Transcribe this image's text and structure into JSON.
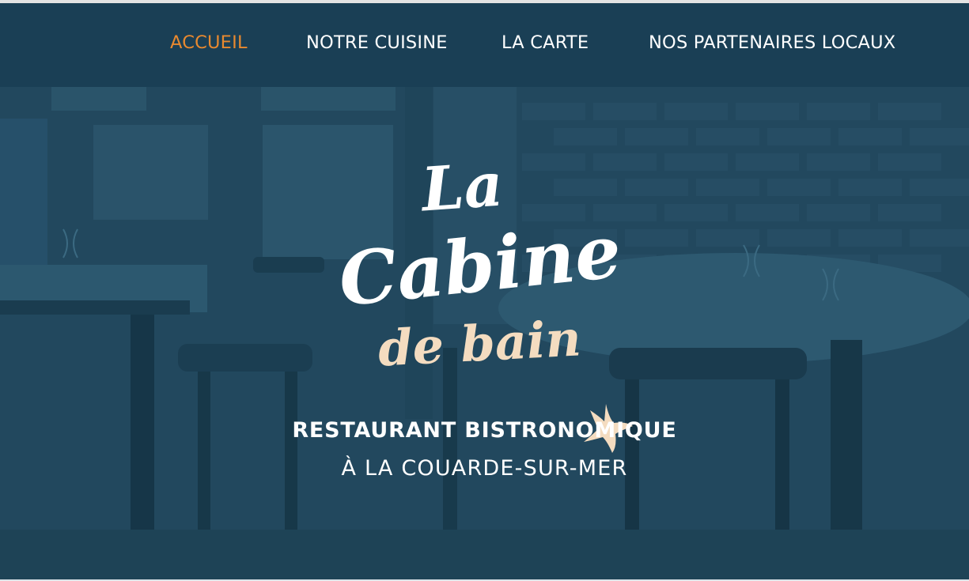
{
  "nav": {
    "items": [
      {
        "label": "ACCUEIL",
        "active": true
      },
      {
        "label": "NOTRE CUISINE",
        "active": false
      },
      {
        "label": "LA CARTE",
        "active": false
      },
      {
        "label": "NOS PARTENAIRES LOCAUX",
        "active": false
      }
    ]
  },
  "logo": {
    "line1": "La",
    "line2": "Cabine",
    "line3": "de bain",
    "icon": "starfish-icon"
  },
  "hero": {
    "tagline_title": "RESTAURANT BISTRONOMIQUE",
    "tagline_subtitle": "À LA COUARDE-SUR-MER"
  },
  "colors": {
    "nav_background": "#1a3f55",
    "active_nav": "#e8892f",
    "overlay": "#1d4358",
    "logo_accent": "#f4dcc0",
    "text": "#ffffff"
  }
}
